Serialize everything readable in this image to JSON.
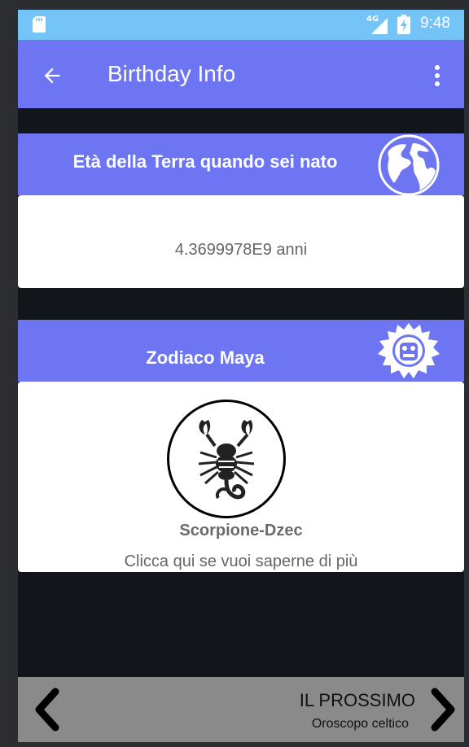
{
  "status_bar": {
    "network": "4G",
    "time": "9:48",
    "icons": [
      "sd-card-icon",
      "signal-icon",
      "battery-charging-icon"
    ]
  },
  "app_bar": {
    "title": "Birthday Info",
    "back_icon": "arrow-back-icon",
    "menu_icon": "more-vert-icon"
  },
  "earth_card": {
    "title": "Età della Terra quando sei nato",
    "icon": "globe-icon",
    "value": "4.3699978E9 anni"
  },
  "maya_card": {
    "title": "Zodiaco Maya",
    "icon": "maya-calendar-icon",
    "sign_icon": "scorpion-icon",
    "sign_name": "Scorpione-Dzec",
    "more_link": "Clicca qui se vuoi saperne di più"
  },
  "bottom_nav": {
    "next_label": "IL PROSSIMO",
    "next_sub": "Oroscopo celtico",
    "prev_icon": "chevron-left-icon",
    "next_icon": "chevron-right-icon"
  },
  "colors": {
    "status_bar": "#74c4f8",
    "accent": "#6d75f3",
    "background": "#12151a",
    "bottom_bar": "#8a8a8a"
  }
}
